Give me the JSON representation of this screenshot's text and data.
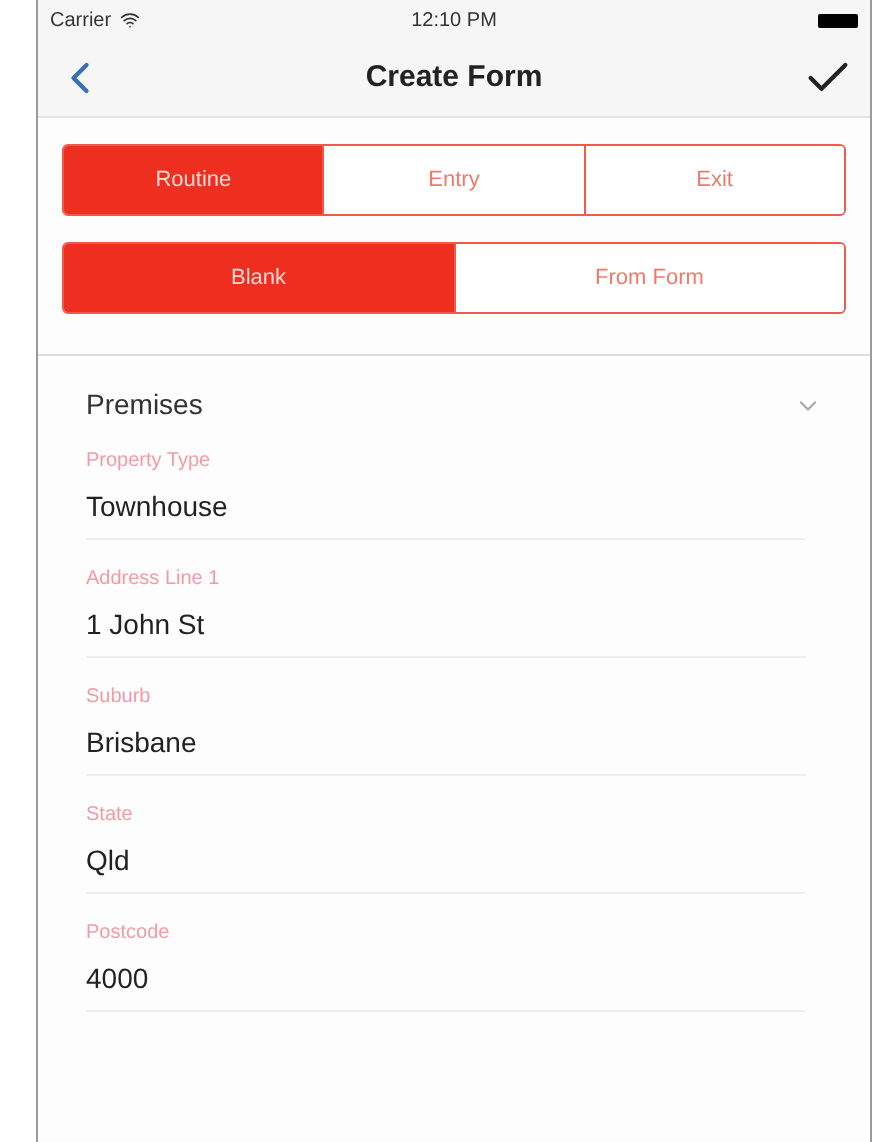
{
  "status_bar": {
    "carrier": "Carrier",
    "time": "12:10 PM"
  },
  "nav_bar": {
    "title": "Create Form"
  },
  "segments_1": [
    {
      "label": "Routine",
      "selected": true
    },
    {
      "label": "Entry",
      "selected": false
    },
    {
      "label": "Exit",
      "selected": false
    }
  ],
  "segments_2": [
    {
      "label": "Blank",
      "selected": true
    },
    {
      "label": "From Form",
      "selected": false
    }
  ],
  "section": {
    "title": "Premises",
    "expanded": true
  },
  "fields": [
    {
      "label": "Property Type",
      "value": "Townhouse"
    },
    {
      "label": "Address Line 1",
      "value": "1 John St"
    },
    {
      "label": "Suburb",
      "value": "Brisbane"
    },
    {
      "label": "State",
      "value": "Qld"
    },
    {
      "label": "Postcode",
      "value": "4000"
    }
  ]
}
